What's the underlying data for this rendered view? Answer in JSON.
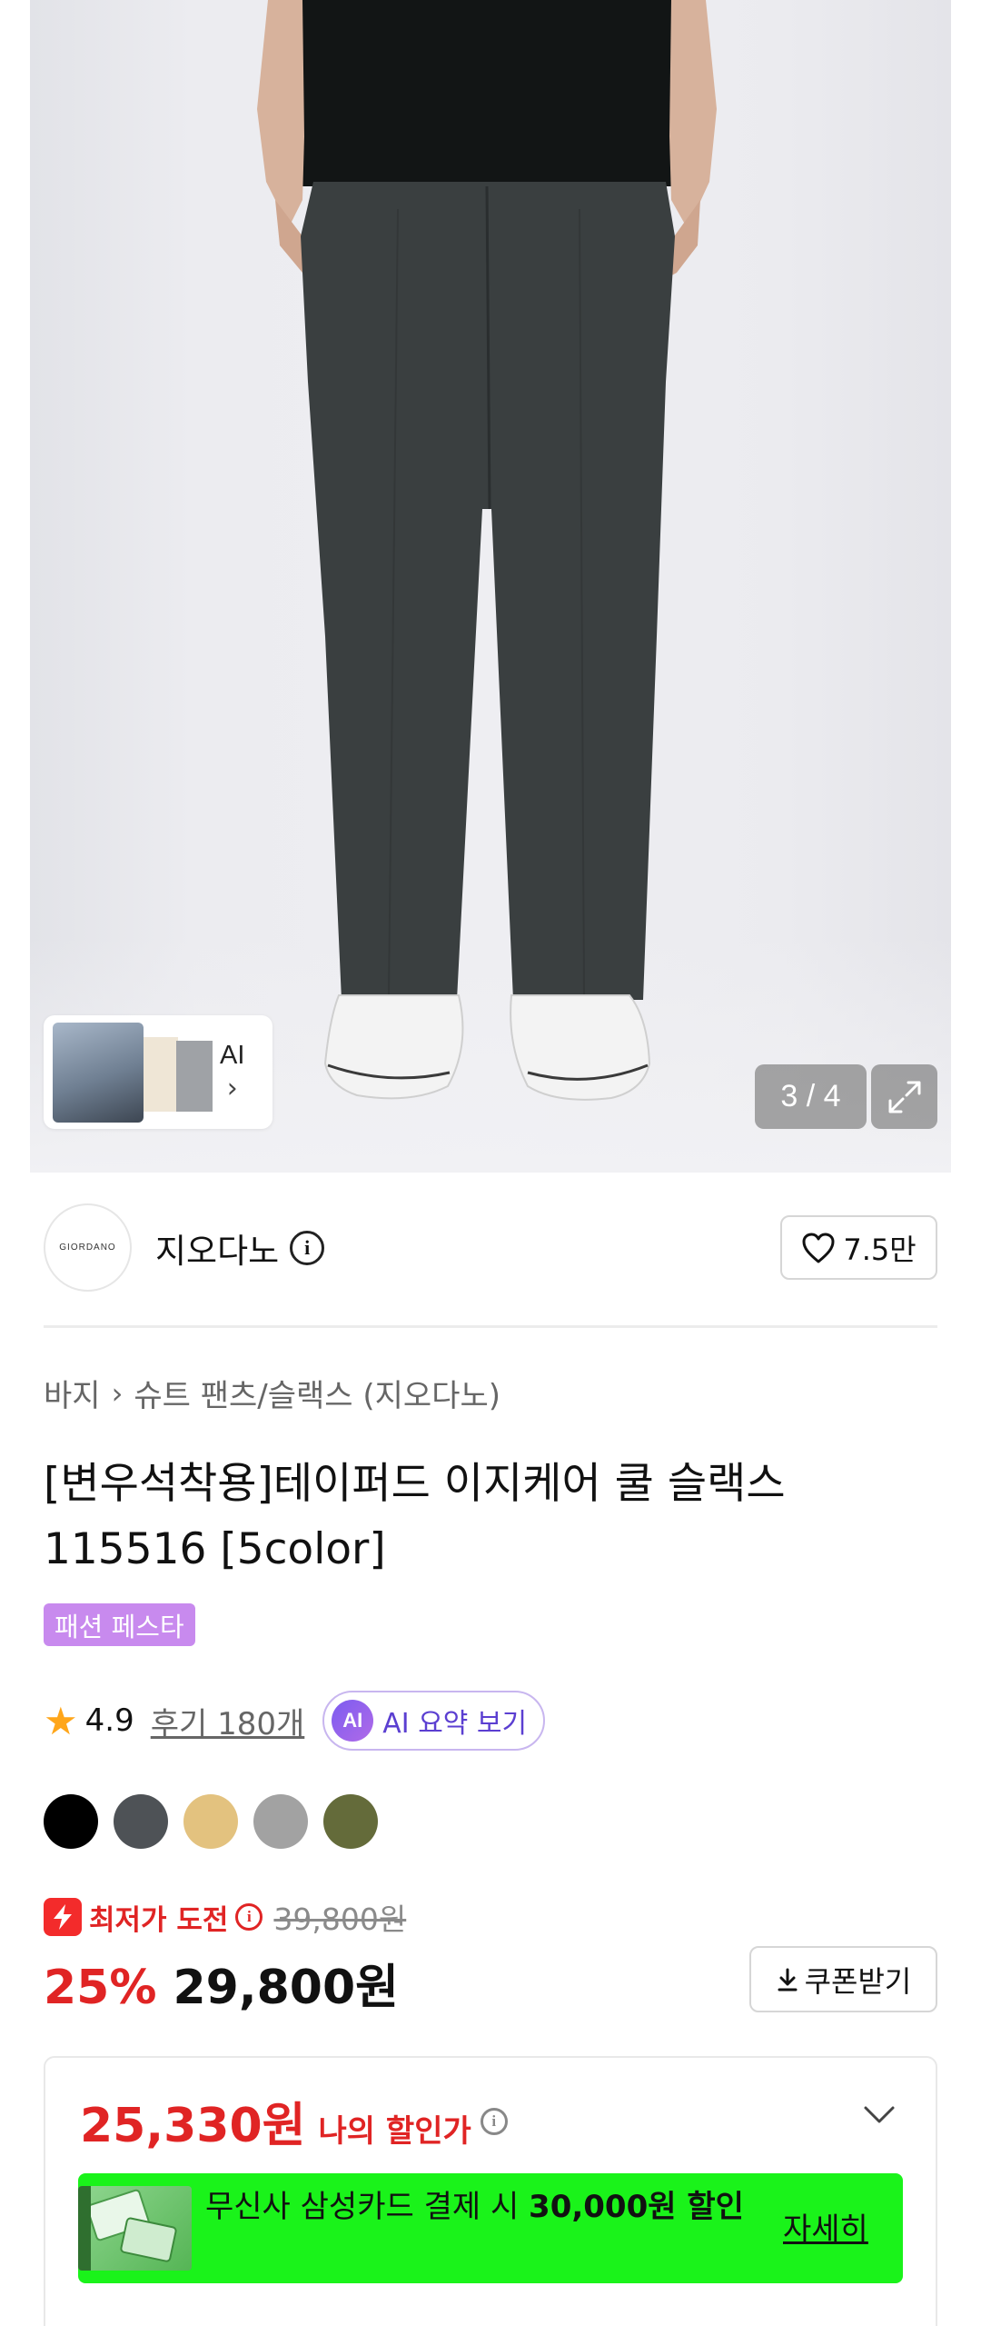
{
  "hero": {
    "counter": "3 / 4",
    "ai_thumb_label": "AI",
    "ai_thumb_chevron": "›",
    "expand_icon": "expand-icon"
  },
  "brand": {
    "logo_text": "GIORDANO",
    "name": "지오다노",
    "info_icon": "i",
    "like_count": "7.5만"
  },
  "breadcrumb": {
    "items": [
      "바지",
      "슈트 팬츠/슬랙스 (지오다노)"
    ],
    "separator": "›"
  },
  "product": {
    "title": "[변우석착용]테이퍼드 이지케어 쿨 슬랙스 115516 [5color]",
    "badge": "패션 페스타"
  },
  "rating": {
    "score": "4.9",
    "review_link": "후기 180개",
    "ai_badge": "AI",
    "ai_summary": "AI 요약 보기"
  },
  "colors": {
    "swatches": [
      "#000000",
      "#4e5256",
      "#e3c27f",
      "#a2a2a2",
      "#646b3a"
    ]
  },
  "price": {
    "lowest_label": "최저가 도전",
    "original": "39,800원",
    "discount": "25%",
    "sale": "29,800원",
    "coupon_button": "쿠폰받기"
  },
  "my_price": {
    "amount": "25,330원",
    "label": "나의 할인가",
    "promo_text_pre": "무신사 삼성카드 결제 시 ",
    "promo_text_bold": "30,000원 할인",
    "promo_more": "자세히"
  },
  "theme": {
    "accent_red": "#e02424",
    "badge_purple": "#c88aee",
    "promo_green": "#1af31a"
  }
}
